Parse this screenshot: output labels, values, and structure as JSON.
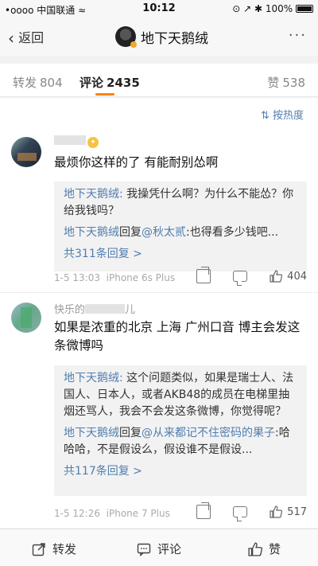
{
  "status_bar": {
    "carrier": "•oooo 中国联通",
    "wifi": "≈",
    "time": "10:12",
    "right": "⊙ ↗ ✱ 100%"
  },
  "nav": {
    "back_label": "返回",
    "title": "地下天鹅绒",
    "more": "···"
  },
  "tabs": [
    {
      "label": "转发",
      "count": "804"
    },
    {
      "label": "评论",
      "count": "2435"
    },
    {
      "label": "赞",
      "count": "538"
    }
  ],
  "sort": {
    "label": "按热度"
  },
  "comments": [
    {
      "text": "最烦你这样的了 有能耐别怂啊",
      "replies": [
        {
          "user": "地下天鹅绒:",
          "text": " 我操凭什么啊？为什么不能怂？你给我钱吗？"
        },
        {
          "user": "地下天鹅绒",
          "mid": "回复",
          "at": "@秋太贰",
          "text": ":也得看多少钱吧..."
        }
      ],
      "more_replies": "共311条回复 >",
      "time": "1-5 13:03",
      "device": "iPhone 6s Plus",
      "likes": "404"
    },
    {
      "username": "快乐的",
      "username_tail": "儿",
      "text": "如果是浓重的北京 上海 广州口音 博主会发这条微博吗",
      "replies": [
        {
          "user": "地下天鹅绒:",
          "text": " 这个问题类似，如果是瑞士人、法国人、日本人，或者AKB48的成员在电梯里抽烟还骂人，我会不会发这条微博，你觉得呢？"
        },
        {
          "user": "地下天鹅绒",
          "mid": "回复",
          "at": "@从来都记不住密码的果子",
          "text": ":哈哈哈，不是假设么，假设谁不是假设..."
        }
      ],
      "more_replies": "共117条回复 >",
      "time": "1-5 12:26",
      "device": "iPhone 7 Plus",
      "likes": "517"
    }
  ],
  "bottom_bar": {
    "repost": "转发",
    "comment": "评论",
    "like": "赞"
  },
  "colors": {
    "accent": "#ff8200",
    "link": "#507daf"
  }
}
